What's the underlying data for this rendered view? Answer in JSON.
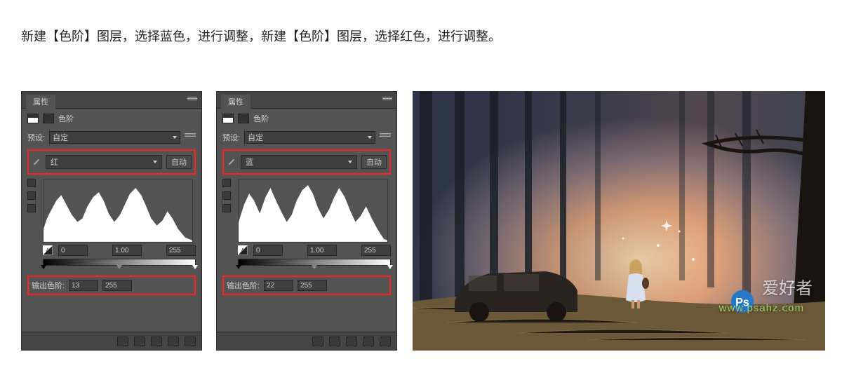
{
  "instruction": "新建【色阶】图层，选择蓝色，进行调整，新建【色阶】图层，选择红色，进行调整。",
  "panel_header_tab": "属性",
  "adjustment_type": "色阶",
  "preset_label": "预设:",
  "preset_value": "自定",
  "auto_button": "自动",
  "output_label": "输出色阶:",
  "panel1": {
    "channel": "红",
    "input_black": "0",
    "input_gamma": "1.00",
    "input_white": "255",
    "output_low": "13",
    "output_high": "255"
  },
  "panel2": {
    "channel": "蓝",
    "input_black": "0",
    "input_gamma": "1.00",
    "input_white": "255",
    "output_low": "22",
    "output_high": "255"
  },
  "watermark_text": "爱好者",
  "watermark_url": "www.psahz.com"
}
